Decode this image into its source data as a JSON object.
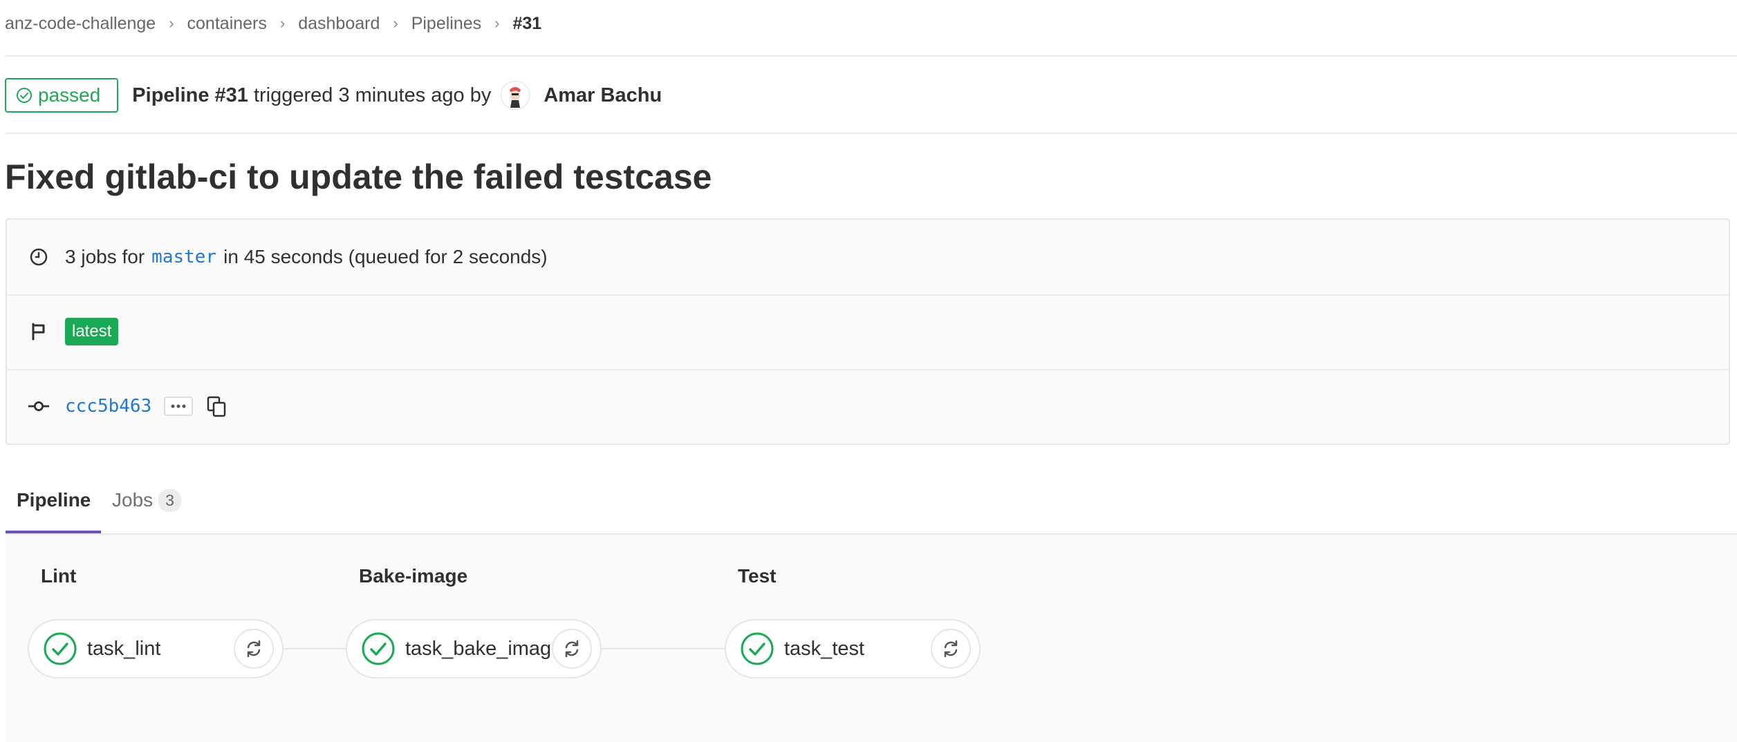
{
  "breadcrumb": {
    "items": [
      "anz-code-challenge",
      "containers",
      "dashboard",
      "Pipelines"
    ],
    "current": "#31"
  },
  "pipeline": {
    "status": "passed",
    "title": "Pipeline #31",
    "triggered_text": "triggered 3 minutes ago by",
    "author": "Amar Bachu",
    "status_color": "#1aaa55"
  },
  "commit": {
    "title": "Fixed gitlab-ci to update the failed testcase",
    "sha": "ccc5b463"
  },
  "info": {
    "jobs_prefix": "3 jobs for",
    "branch": "master",
    "jobs_suffix": "in 45 seconds (queued for 2 seconds)",
    "tag": "latest"
  },
  "tabs": [
    {
      "label": "Pipeline",
      "active": true
    },
    {
      "label": "Jobs",
      "count": "3",
      "active": false
    }
  ],
  "stages": [
    {
      "title": "Lint",
      "job": "task_lint",
      "status": "success"
    },
    {
      "title": "Bake-image",
      "job": "task_bake_image",
      "status": "success"
    },
    {
      "title": "Test",
      "job": "task_test",
      "status": "success"
    }
  ],
  "icons": {
    "status": "check-circle-icon",
    "clock": "clock-icon",
    "flag": "flag-icon",
    "commit": "commit-icon",
    "copy": "copy-icon",
    "retry": "retry-icon"
  },
  "colors": {
    "accent": "#6b4fbb",
    "link": "#1f78d1",
    "success": "#1aaa55"
  }
}
